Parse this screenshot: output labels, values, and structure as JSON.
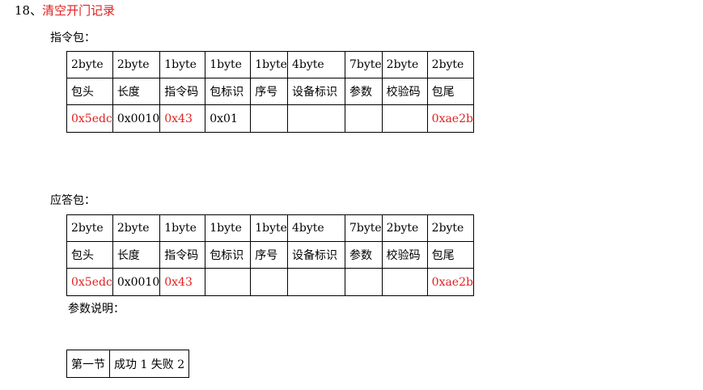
{
  "heading": {
    "number": "18、",
    "title": "清空开门记录"
  },
  "command_label": "指令包：",
  "response_label": "应答包：",
  "params_label": "参数说明：",
  "command_table": {
    "sizes": [
      "2byte",
      "2byte",
      "1byte",
      "1byte",
      "1byte",
      "4byte",
      "7byte",
      "2byte",
      "2byte"
    ],
    "fields": [
      "包头",
      "长度",
      "指令码",
      "包标识",
      "序号",
      "设备标识",
      "参数",
      "校验码",
      "包尾"
    ],
    "values": [
      "0x5edc",
      "0x0010",
      "0x43",
      "0x01",
      "",
      "",
      "",
      "",
      "0xae2b"
    ]
  },
  "response_table": {
    "sizes": [
      "2byte",
      "2byte",
      "1byte",
      "1byte",
      "1byte",
      "4byte",
      "7byte",
      "2byte",
      "2byte"
    ],
    "fields": [
      "包头",
      "长度",
      "指令码",
      "包标识",
      "序号",
      "设备标识",
      "参数",
      "校验码",
      "包尾"
    ],
    "values": [
      "0x5edc",
      "0x0010",
      "0x43",
      "",
      "",
      "",
      "",
      "",
      "0xae2b"
    ]
  },
  "params_table": {
    "byte_label": "第一节",
    "description": "成功 1  失败 2"
  },
  "colors": {
    "highlight": "#e02020",
    "text": "#000000",
    "border": "#000000"
  }
}
